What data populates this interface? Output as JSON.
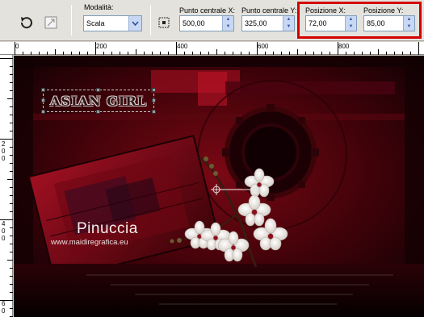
{
  "toolbar": {
    "mode_label": "Modalità:",
    "mode_value": "Scala",
    "center_x_label": "Punto centrale X:",
    "center_x_value": "500,00",
    "center_y_label": "Punto centrale Y:",
    "center_y_value": "325,00",
    "pos_x_label": "Posizione X:",
    "pos_x_value": "72,00",
    "pos_y_label": "Posizione Y:",
    "pos_y_value": "85,00"
  },
  "ruler": {
    "top_labels": [
      "0",
      "200",
      "400",
      "600",
      "800"
    ],
    "left_labels": [
      "2",
      "0",
      "0",
      "4",
      "0",
      "0",
      "6",
      "0"
    ]
  },
  "canvas": {
    "logo_text": "ASIAN GIRL",
    "watermark_name": "Pinuccia",
    "watermark_url": "www.maidiregrafica.eu"
  },
  "colors": {
    "highlight": "#d40000",
    "canvas_dark": "#1a0305",
    "canvas_red": "#8a0a18"
  }
}
